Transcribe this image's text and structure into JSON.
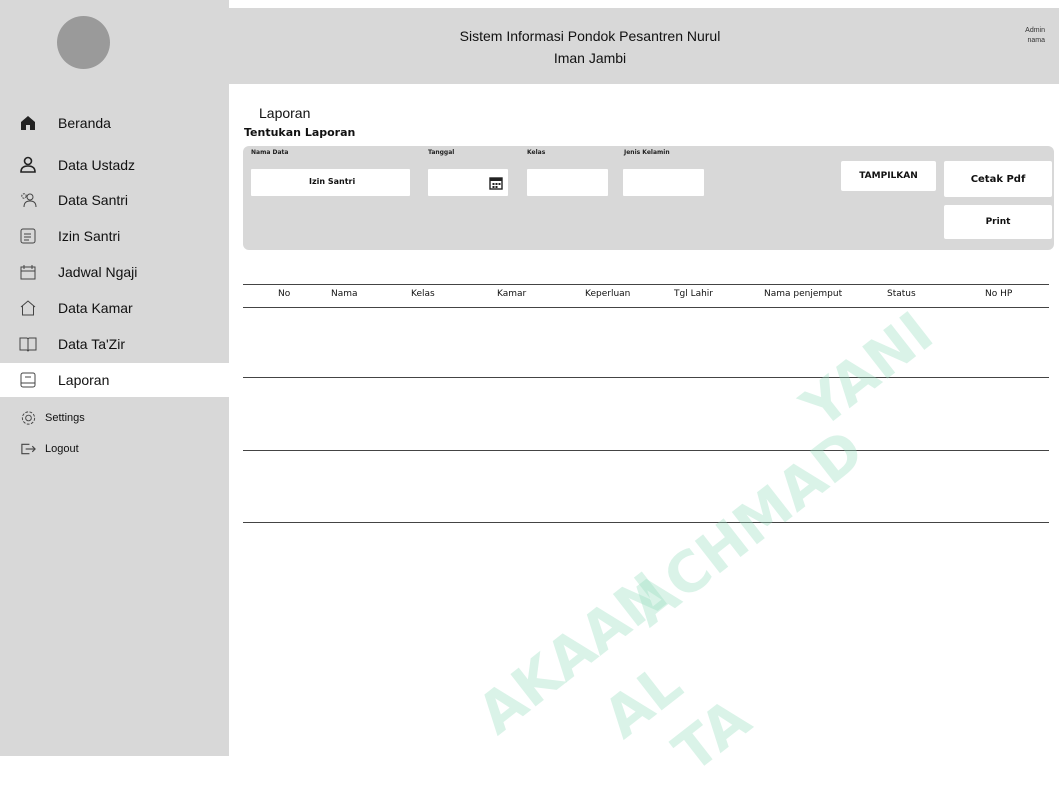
{
  "header": {
    "title_line1": "Sistem Informasi Pondok Pesantren Nurul",
    "title_line2": "Iman Jambi",
    "admin_line1": "Admin",
    "admin_line2": "nama"
  },
  "sidebar": {
    "items": [
      {
        "label": "Beranda",
        "icon": "home-icon",
        "active": false
      },
      {
        "label": "Data Ustadz",
        "icon": "user-icon",
        "active": false
      },
      {
        "label": "Data Santri",
        "icon": "users-icon",
        "active": false
      },
      {
        "label": "Izin Santri",
        "icon": "document-icon",
        "active": false
      },
      {
        "label": "Jadwal Ngaji",
        "icon": "calendar-icon",
        "active": false
      },
      {
        "label": "Data Kamar",
        "icon": "house-outline-icon",
        "active": false
      },
      {
        "label": "Data Ta'Zir",
        "icon": "book-icon",
        "active": false
      },
      {
        "label": "Laporan",
        "icon": "report-icon",
        "active": true
      }
    ],
    "bottom": [
      {
        "label": "Settings",
        "icon": "gear-icon"
      },
      {
        "label": "Logout",
        "icon": "logout-icon"
      }
    ]
  },
  "main": {
    "page_title": "Laporan",
    "section_title": "Tentukan Laporan",
    "filters": {
      "nama_data_label": "Nama Data",
      "nama_data_value": "Izin Santri",
      "tanggal_label": "Tanggal",
      "kelas_label": "Kelas",
      "jenis_kelamin_label": "Jenis Kelamin"
    },
    "buttons": {
      "tampilkan": "TAMPILKAN",
      "cetak_pdf": "Cetak Pdf",
      "print": "Print"
    },
    "table": {
      "columns": [
        "No",
        "Nama",
        "Kelas",
        "Kamar",
        "Keperluan",
        "Tgl Lahir",
        "Nama penjemput",
        "Status",
        "No HP"
      ],
      "rows": []
    }
  },
  "watermark": {
    "lines": [
      "YANI",
      "ACHMAD",
      "AKAAN",
      "AL",
      "TA"
    ]
  },
  "colors": {
    "sidebar_bg": "#d8d8d8",
    "header_bg": "#d8d8d8",
    "panel_bg": "#d8d8d8",
    "active_item_bg": "#ffffff",
    "watermark": "#96dcbe"
  }
}
